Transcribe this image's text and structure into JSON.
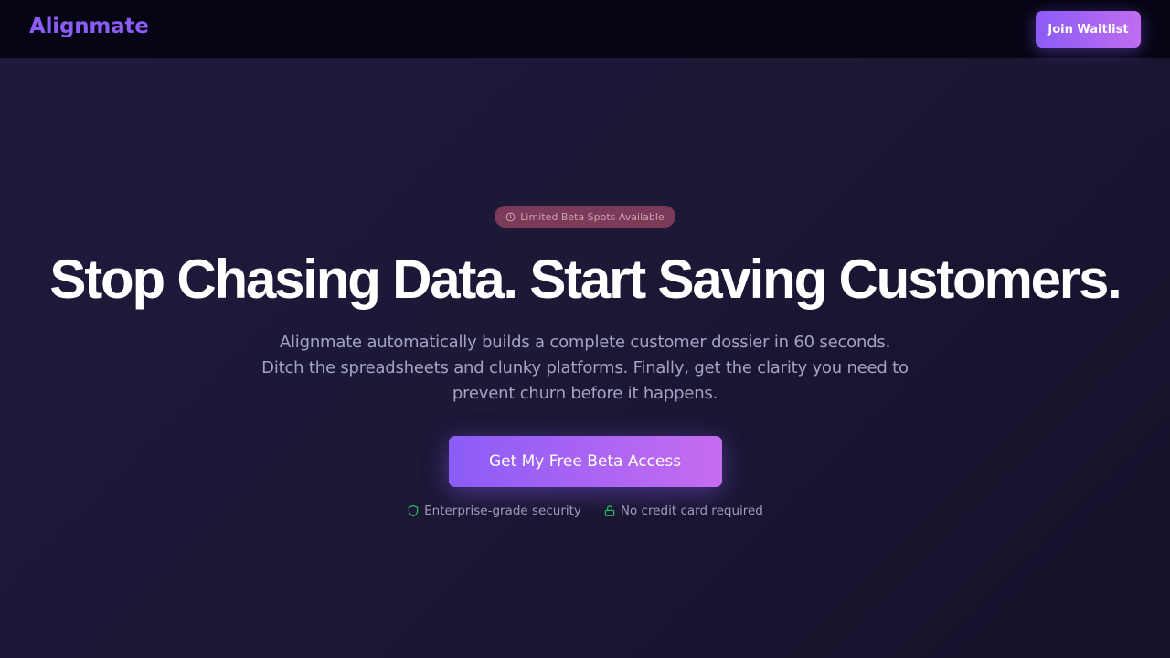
{
  "nav": {
    "brand": "Alignmate",
    "cta_label": "Join Waitlist"
  },
  "hero": {
    "badge": {
      "icon": "clock-icon",
      "label": "Limited Beta Spots Available"
    },
    "headline": "Stop Chasing Data. Start Saving Customers.",
    "subheadline_lines": [
      "Alignmate automatically builds a complete customer dossier in 60 seconds.",
      "Ditch the spreadsheets and clunky platforms. Finally, get the clarity you need to",
      "prevent churn before it happens."
    ],
    "cta_label": "Get My Free Beta Access",
    "trust": [
      {
        "icon": "shield-icon",
        "label": "Enterprise-grade security"
      },
      {
        "icon": "lock-icon",
        "label": "No credit card required"
      }
    ]
  },
  "colors": {
    "brand": "#8b5cf6",
    "accent_gradient_end": "#c66cf0",
    "nav_bg": "#050514",
    "badge_bg": "#7a3a58",
    "trust_icon": "#22c55e",
    "text_muted": "#a3a4c4"
  }
}
